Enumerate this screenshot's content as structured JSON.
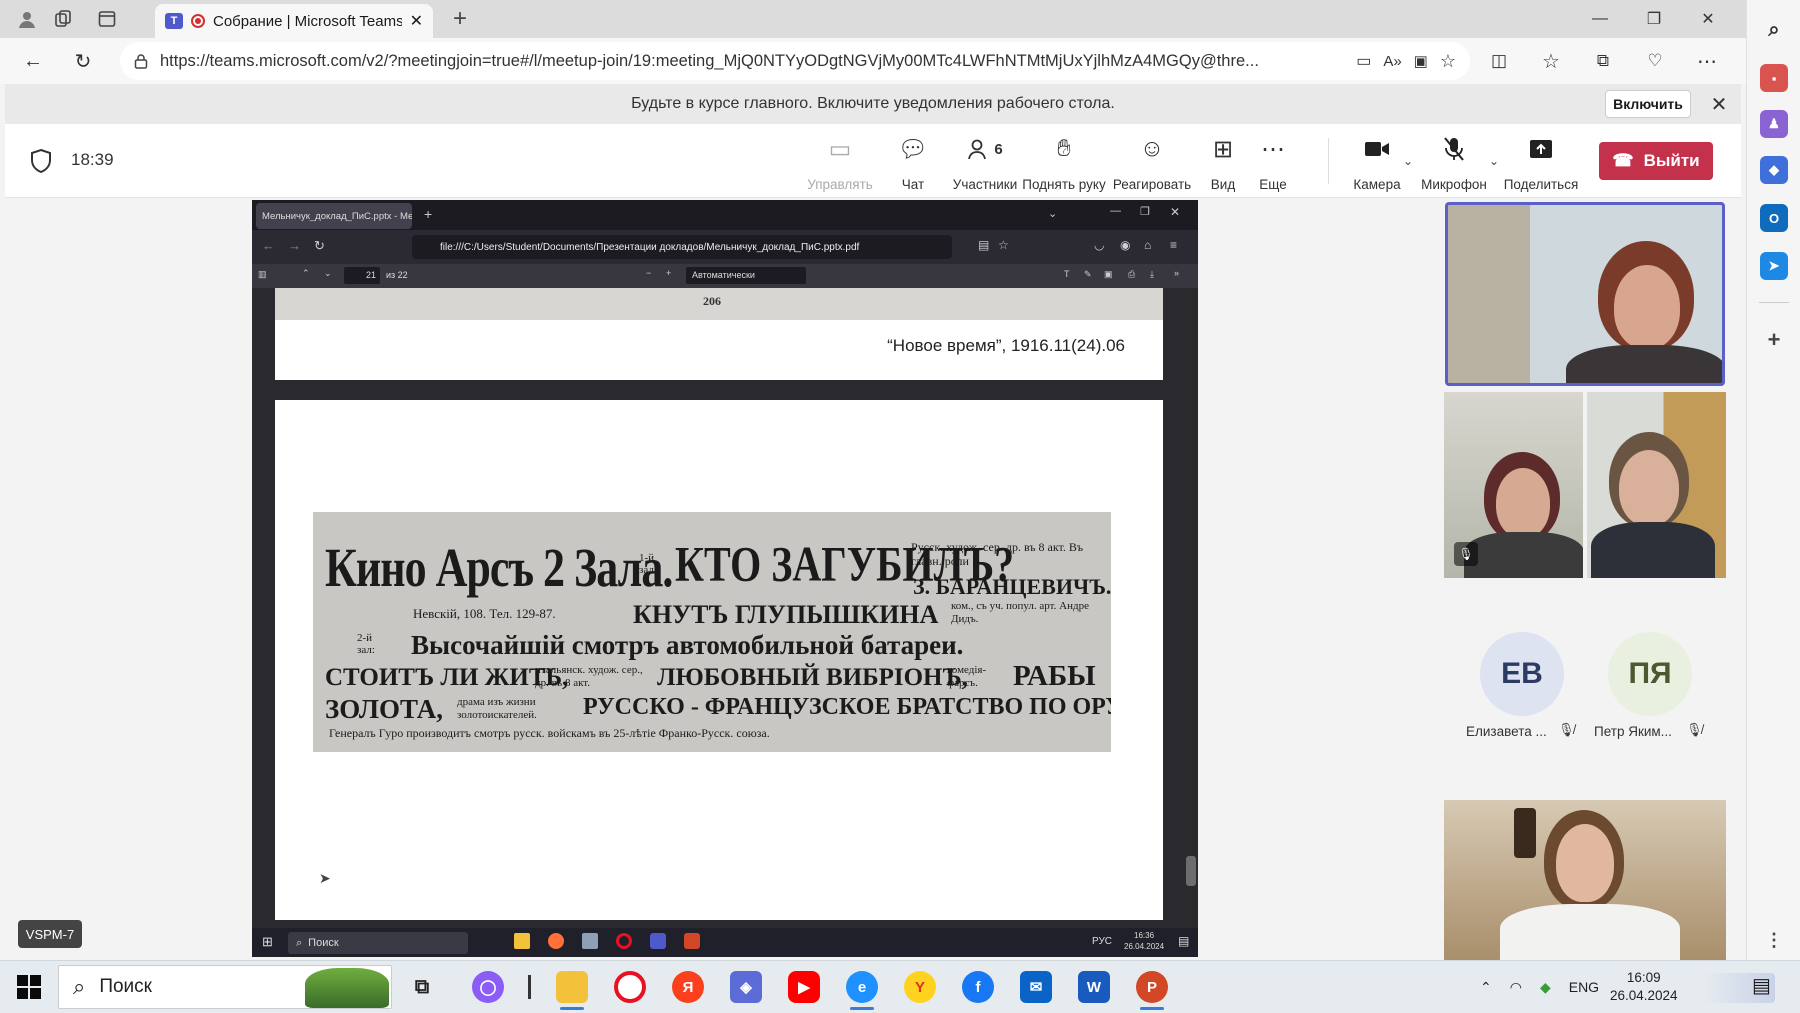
{
  "browser": {
    "tab_title": "Собрание | Microsoft Teams",
    "url": "https://teams.microsoft.com/v2/?meetingjoin=true#/l/meetup-join/19:meeting_MjQ0NTYyODgtNGVjMy00MTc4LWFhNTMtMjUxYjlhMzA4MGQy@thre..."
  },
  "notification": {
    "text": "Будьте в курсе главного. Включите уведомления рабочего стола.",
    "button": "Включить"
  },
  "meeting": {
    "time": "18:39",
    "toolbar": {
      "manage": "Управлять",
      "chat": "Чат",
      "participants": "Участники",
      "participants_count": "6",
      "raise_hand": "Поднять руку",
      "react": "Реагировать",
      "view": "Вид",
      "more": "Еще",
      "camera": "Камера",
      "mic": "Микрофон",
      "share": "Поделиться",
      "leave": "Выйти"
    }
  },
  "shared_screen": {
    "tab_title": "Мельничук_доклад_ПиС.pptx - Мельн",
    "url": "file:///C:/Users/Student/Documents/Презентации докладов/Мельничук_доклад_ПиС.pptx.pdf",
    "page_current": "21",
    "page_total": "из 22",
    "zoom": "Автоматически",
    "page_number_top": "206",
    "caption": "“Новое время”, 1916.11(24).06",
    "clip": {
      "headline_left": "Кино Арсъ 2 Зала.",
      "hall1": "1-й зал:",
      "headline_center": "КТО ЗАГУБИЛЪ?",
      "genre1": "Русск. худож. сер. др. въ 8 акт. Въ главн. роли",
      "actor1": "З. БАРАНЦЕВИЧЪ.",
      "address": "Невскій, 108. Тел. 129-87.",
      "knut": "КНУТЪ ГЛУПЫШКИНА",
      "knut_note": "ком., съ уч. попул. арт. Андре Дидъ.",
      "hall2": "2-й зал:",
      "review": "Высочайшій смотръ автомобильной батареи.",
      "stoit": "СТОИТЪ ЛИ ЖИТЬ,",
      "stoit_note": "итальянск. худож. сер., др. въ 8 акт.",
      "vibrion": "ЛЮБОВНЫЙ ВИБРІОНЪ,",
      "vibrion_note": "комедія-фарсъ.",
      "raby": "РАБЫ",
      "zolota": "ЗОЛОТА,",
      "zolota_note": "драма изъ жизни золотоискателей.",
      "bratstvo": "РУССКО - ФРАНЦУЗСКОЕ БРАТСТВО ПО ОРУЖІЮ.",
      "footer": "Генералъ Гуро производитъ смотръ русск. войскамъ въ 25-лѣтіе Франко-Русск. союза."
    },
    "inner_taskbar": {
      "search": "Поиск",
      "lang": "РУС",
      "time": "16:36",
      "date": "26.04.2024"
    }
  },
  "participants": [
    {
      "initials": "ЕВ",
      "name": "Елизавета ...",
      "color": "#dde3f0",
      "text_color": "#2d3a63"
    },
    {
      "initials": "ПЯ",
      "name": "Петр Яким...",
      "color": "#eaf0df",
      "text_color": "#4a5a2e"
    }
  ],
  "device_label": "VSPM-7",
  "taskbar": {
    "search": "Поиск",
    "lang": "ENG",
    "time": "16:09",
    "date": "26.04.2024"
  }
}
